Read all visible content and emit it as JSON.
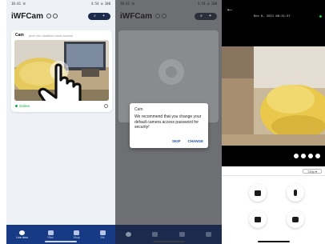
{
  "screens": {
    "home": {
      "status_left": "10:41 ☰",
      "status_right": "4:54 ⚙ 100",
      "app_title": "iWFCam",
      "camera_name": "Cam",
      "camera_hint": "pixel info disabled ones access",
      "online_label": "Online",
      "nav": [
        "Live view",
        "Files",
        "Shop",
        "Me"
      ]
    },
    "dialog_screen": {
      "status_left": "10:41 ☰",
      "status_right": "4:54 ⚙ 100",
      "app_title": "iWFCam",
      "dialog": {
        "title": "Cam",
        "body": "We recommend that you change your default camera access password for security!",
        "skip_label": "SKIP",
        "change_label": "CHANGE"
      }
    },
    "live": {
      "back_glyph": "←",
      "timestamp": "Dec 8, 2021 00:31:57",
      "resolution": "720p"
    }
  },
  "colors": {
    "brand": "#173a85",
    "online": "#1aa64a",
    "dialog_action": "#1f4fae"
  }
}
